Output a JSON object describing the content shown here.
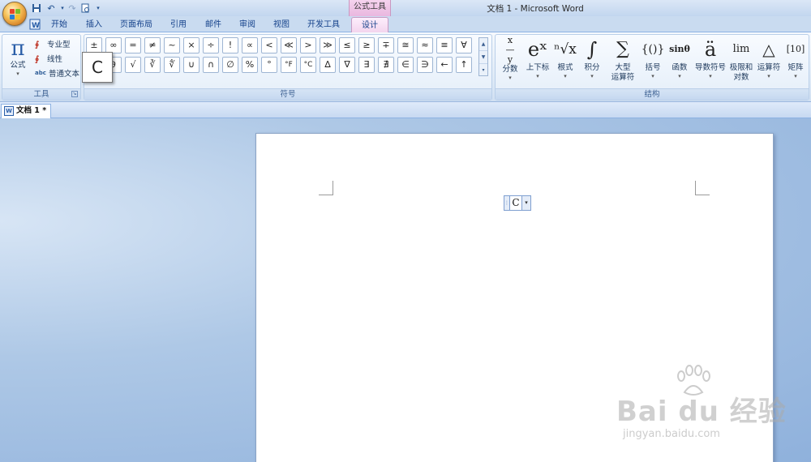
{
  "window": {
    "title": "文档 1 - Microsoft Word",
    "context_tab_title": "公式工具"
  },
  "tabs": [
    {
      "label": "开始"
    },
    {
      "label": "插入"
    },
    {
      "label": "页面布局"
    },
    {
      "label": "引用"
    },
    {
      "label": "邮件"
    },
    {
      "label": "审阅"
    },
    {
      "label": "视图"
    },
    {
      "label": "开发工具"
    },
    {
      "label": "设计",
      "active": true
    }
  ],
  "ribbon": {
    "tools_group": {
      "label": "工具",
      "formula_label": "公式",
      "professional_label": "专业型",
      "linear_label": "线性",
      "plain_text_label": "普通文本",
      "plain_text_icon": "abc"
    },
    "symbols_group": {
      "label": "符号",
      "row1": [
        "±",
        "∞",
        "=",
        "≠",
        "~",
        "×",
        "÷",
        "!",
        "∝",
        "<",
        "≪",
        ">",
        "≫",
        "≤",
        "≥",
        "∓",
        "≅",
        "≈",
        "≡",
        "∀"
      ],
      "row2": [
        "",
        "∂",
        "√",
        "∛",
        "∜",
        "∪",
        "∩",
        "∅",
        "%",
        "°",
        "°F",
        "°C",
        "∆",
        "∇",
        "∃",
        "∄",
        "∈",
        "∋",
        "←",
        "↑"
      ]
    },
    "structures_group": {
      "label": "结构",
      "buttons": [
        {
          "glyph": "x/y",
          "label": "分数"
        },
        {
          "glyph": "eˣ",
          "label": "上下标"
        },
        {
          "glyph": "ⁿ√x",
          "label": "根式"
        },
        {
          "glyph": "∫",
          "label": "积分"
        },
        {
          "glyph": "∑",
          "label": "大型",
          "label2": "运算符"
        },
        {
          "glyph": "{()}",
          "label": "括号"
        },
        {
          "glyph": "sinθ",
          "label": "函数"
        },
        {
          "glyph": "ä",
          "label": "导数符号"
        },
        {
          "glyph": "lim",
          "label": "极限和",
          "label2": "对数"
        },
        {
          "glyph": "△",
          "label": "运算符"
        },
        {
          "glyph": "[10]",
          "label": "矩阵"
        }
      ]
    }
  },
  "tooltip": {
    "text": "C"
  },
  "document": {
    "tab_label": "文档 1 *",
    "equation_text": "C"
  },
  "watermark": {
    "brand": "Bai du 经验",
    "sub": "jingyan.baidu.com"
  },
  "colors": {
    "accent": "#15428b",
    "context_tab": "#f3d5ee",
    "workspace": "#a5bfe0"
  }
}
